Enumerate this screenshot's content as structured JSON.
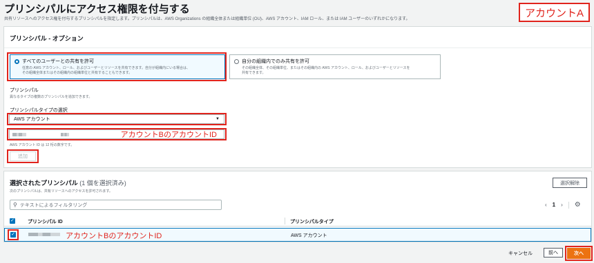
{
  "page": {
    "title": "プリンシパルにアクセス権限を付与する",
    "description": "共有リソースへのアクセス権を付与するプリンシパルを指定します。プリンシパルは、AWS Organizations の組織全体または組織単位 (OU)、AWS アカウント、IAM ロール、または IAM ユーザーのいずれかになります。",
    "annotation_account_a": "アカウントA"
  },
  "options_panel": {
    "title": "プリンシパル - オプション",
    "option_all": {
      "label": "すべてのユーザーとの共有を許可",
      "desc1": "任意の AWS アカウント、ロール、およびユーザーとリソースを共有できます。自分が組織内にいる場合は、",
      "desc2": "その組織全体またはその組織内の組織単位と共有することもできます。"
    },
    "option_org": {
      "label": "自分の組織内でのみ共有を許可",
      "desc1": "その組織全体、その組織単位、またはその組織内の AWS アカウント、ロール、およびユーザーとリソースを",
      "desc2": "共有できます。"
    },
    "principal_label": "プリンシパル",
    "principal_sub": "異なるタイプの複数のプリンシパルを追加できます。",
    "type_label": "プリンシパルタイプの選択",
    "type_value": "AWS アカウント",
    "input_annotation": "アカウントBのアカウントID",
    "input_hint": "AWS アカウント ID は 12 桁の数字です。",
    "add_button": "追加"
  },
  "selected_panel": {
    "title": "選択されたプリンシパル",
    "count": "(1 個を選択済み)",
    "sub": "次のプリンシパルは、共有リソースへのアクセスを許可されます。",
    "deselect_button": "選択解除",
    "filter_placeholder": "テキストによるフィルタリング",
    "page_number": "1",
    "columns": [
      "プリンシパル ID",
      "プリンシパルタイプ"
    ],
    "rows": [
      {
        "id_annotation": "アカウントBのアカウントID",
        "type": "AWS アカウント"
      }
    ]
  },
  "footer": {
    "cancel": "キャンセル",
    "prev": "前へ",
    "next": "次へ"
  }
}
